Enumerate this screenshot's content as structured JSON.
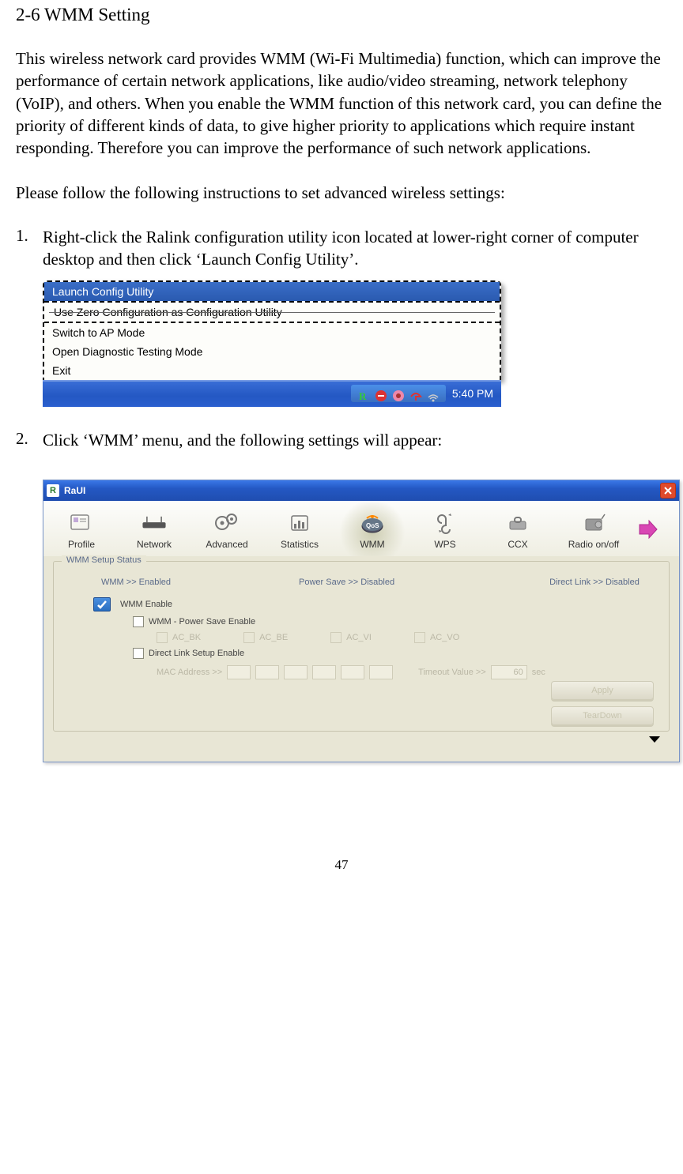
{
  "heading": "2-6 WMM Setting",
  "para1": "This wireless network card provides WMM (Wi-Fi Multimedia) function, which can improve the performance of certain network applications, like audio/video streaming, network telephony (VoIP), and others. When you enable the WMM function of this network card, you can define the priority of different kinds of data, to give higher priority to applications which require instant responding. Therefore you can improve the performance of such network applications.",
  "para2": "Please follow the following instructions to set advanced wireless settings:",
  "step1_num": "1.",
  "step1_text": "Right-click the Ralink configuration utility icon located at lower-right corner of computer desktop and then click ‘Launch Config Utility’.",
  "step2_num": "2.",
  "step2_text": "Click ‘WMM’ menu, and the following settings will appear:",
  "ctx_menu": {
    "launch": "Launch Config Utility",
    "zerocfg": "Use Zero Configuration as Configuration Utility",
    "switch_ap": "Switch to AP Mode",
    "open_diag": "Open Diagnostic Testing Mode",
    "exit": "Exit",
    "clock": "5:40 PM"
  },
  "raui": {
    "title_icon": "R",
    "title": "RaUI",
    "toolbar": {
      "profile": "Profile",
      "network": "Network",
      "advanced": "Advanced",
      "statistics": "Statistics",
      "wmm": "WMM",
      "wps": "WPS",
      "ccx": "CCX",
      "radio": "Radio on/off"
    },
    "legend": "WMM Setup Status",
    "status": {
      "wmm": "WMM >> Enabled",
      "power": "Power Save >> Disabled",
      "dls": "Direct Link >> Disabled"
    },
    "options": {
      "wmm_enable": "WMM Enable",
      "ps_enable": "WMM - Power Save Enable",
      "ac_bk": "AC_BK",
      "ac_be": "AC_BE",
      "ac_vi": "AC_VI",
      "ac_vo": "AC_VO",
      "dls_enable": "Direct Link Setup Enable",
      "mac_label": "MAC Address >>",
      "timeout_label": "Timeout Value >>",
      "timeout_val": "60",
      "timeout_unit": "sec"
    },
    "buttons": {
      "apply": "Apply",
      "teardown": "TearDown"
    }
  },
  "page_num": "47"
}
